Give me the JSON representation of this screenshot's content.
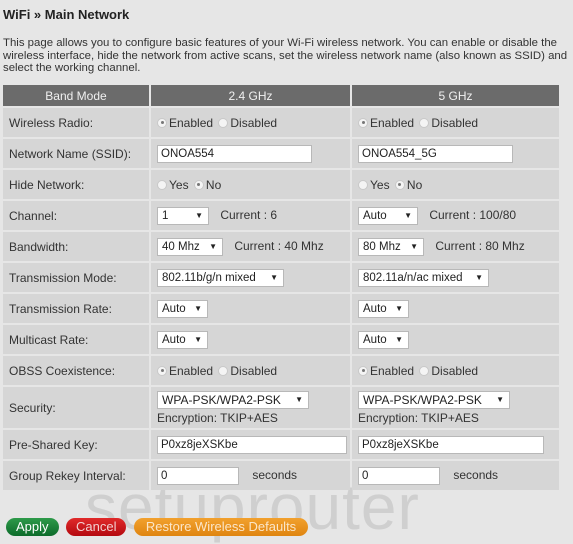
{
  "page": {
    "title": "WiFi » Main Network",
    "description": "This page allows you to configure basic features of your Wi-Fi wireless network. You can enable or disable the wireless interface, hide the network from active scans, set the wireless network name (also known as SSID) and select the working channel."
  },
  "table": {
    "headers": [
      "Band Mode",
      "2.4 GHz",
      "5 GHz"
    ],
    "labels": {
      "wireless_radio": "Wireless Radio:",
      "ssid": "Network Name (SSID):",
      "hide_network": "Hide Network:",
      "channel": "Channel:",
      "bandwidth": "Bandwidth:",
      "tx_mode": "Transmission Mode:",
      "tx_rate": "Transmission Rate:",
      "multicast_rate": "Multicast Rate:",
      "obss": "OBSS Coexistence:",
      "security": "Security:",
      "psk": "Pre-Shared Key:",
      "rekey": "Group Rekey Interval:"
    },
    "common": {
      "enabled": "Enabled",
      "disabled": "Disabled",
      "yes": "Yes",
      "no": "No",
      "current_label": "Current :",
      "seconds": "seconds",
      "arrow": "▼"
    },
    "band24": {
      "wireless_radio": "Enabled",
      "ssid": "ONOA554",
      "hide_network": "No",
      "channel": "1",
      "channel_current": "6",
      "bandwidth": "40 Mhz",
      "bandwidth_current": "40 Mhz",
      "tx_mode": "802.11b/g/n mixed",
      "tx_rate": "Auto",
      "multicast_rate": "Auto",
      "obss": "Enabled",
      "security": "WPA-PSK/WPA2-PSK",
      "encryption": "Encryption: TKIP+AES",
      "psk": "P0xz8jeXSKbe",
      "rekey": "0"
    },
    "band5": {
      "wireless_radio": "Enabled",
      "ssid": "ONOA554_5G",
      "hide_network": "No",
      "channel": "Auto",
      "channel_current": "100/80",
      "bandwidth": "80 Mhz",
      "bandwidth_current": "80 Mhz",
      "tx_mode": "802.11a/n/ac mixed",
      "tx_rate": "Auto",
      "multicast_rate": "Auto",
      "obss": "Enabled",
      "security": "WPA-PSK/WPA2-PSK",
      "encryption": "Encryption: TKIP+AES",
      "psk": "P0xz8jeXSKbe",
      "rekey": "0"
    }
  },
  "buttons": {
    "apply": "Apply",
    "cancel": "Cancel",
    "restore": "Restore Wireless Defaults"
  },
  "watermark": "setuprouter"
}
